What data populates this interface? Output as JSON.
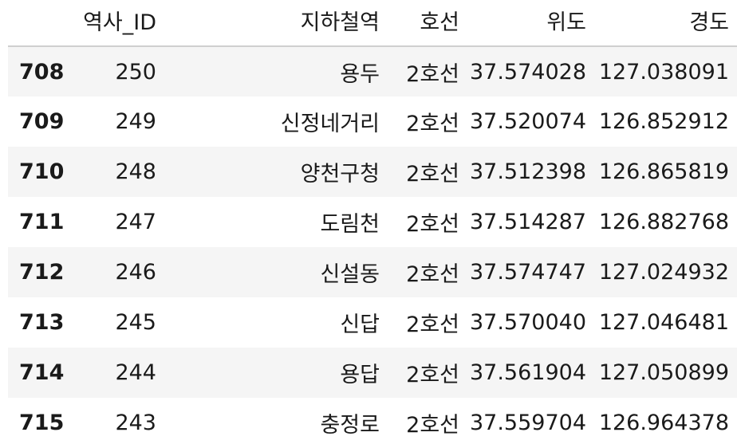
{
  "table": {
    "columns": [
      "",
      "역사_ID",
      "지하철역",
      "호선",
      "위도",
      "경도"
    ],
    "rows": [
      {
        "index": "708",
        "id": "250",
        "station": "용두",
        "line": "2호선",
        "lat": "37.574028",
        "lng": "127.038091"
      },
      {
        "index": "709",
        "id": "249",
        "station": "신정네거리",
        "line": "2호선",
        "lat": "37.520074",
        "lng": "126.852912"
      },
      {
        "index": "710",
        "id": "248",
        "station": "양천구청",
        "line": "2호선",
        "lat": "37.512398",
        "lng": "126.865819"
      },
      {
        "index": "711",
        "id": "247",
        "station": "도림천",
        "line": "2호선",
        "lat": "37.514287",
        "lng": "126.882768"
      },
      {
        "index": "712",
        "id": "246",
        "station": "신설동",
        "line": "2호선",
        "lat": "37.574747",
        "lng": "127.024932"
      },
      {
        "index": "713",
        "id": "245",
        "station": "신답",
        "line": "2호선",
        "lat": "37.570040",
        "lng": "127.046481"
      },
      {
        "index": "714",
        "id": "244",
        "station": "용답",
        "line": "2호선",
        "lat": "37.561904",
        "lng": "127.050899"
      },
      {
        "index": "715",
        "id": "243",
        "station": "충정로",
        "line": "2호선",
        "lat": "37.559704",
        "lng": "126.964378"
      }
    ]
  }
}
